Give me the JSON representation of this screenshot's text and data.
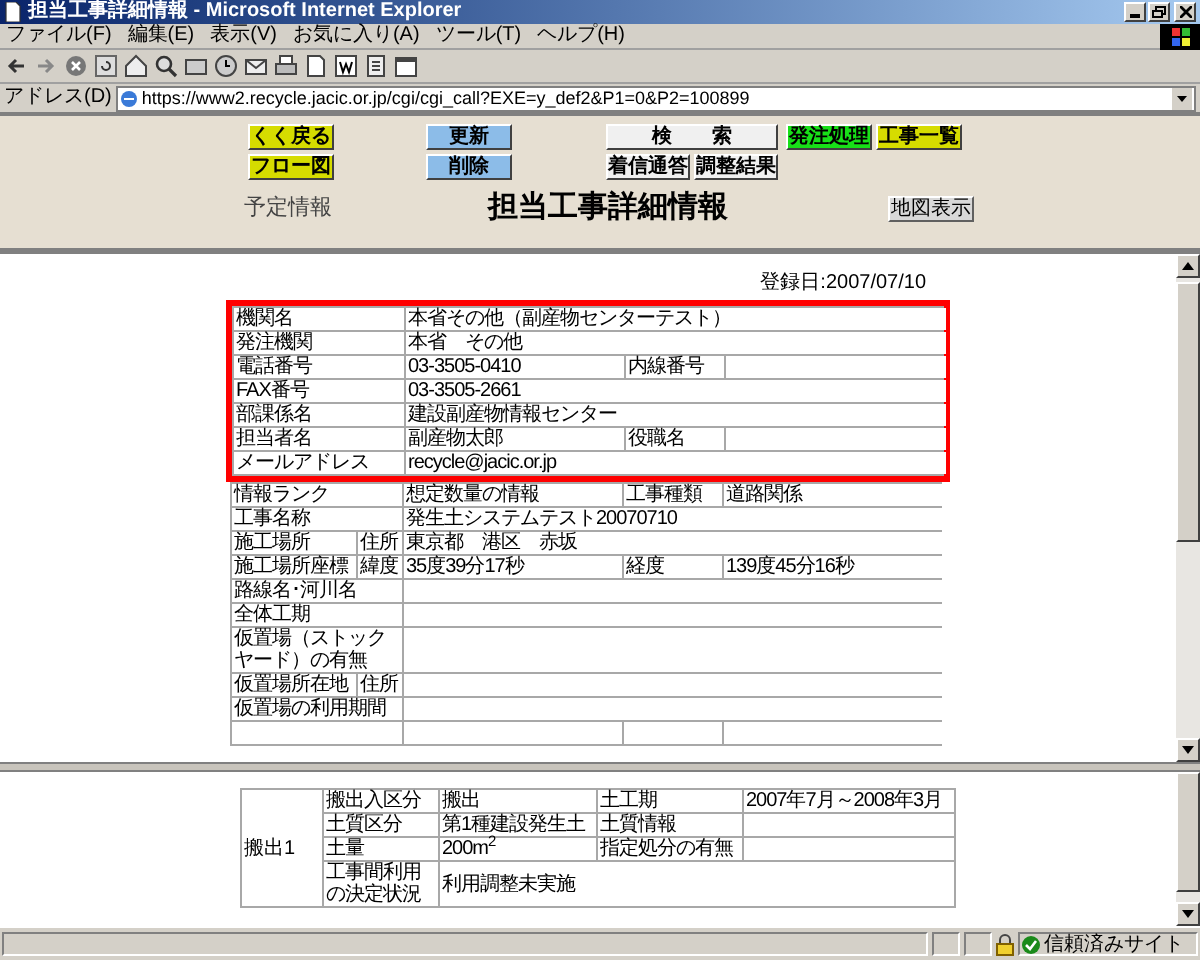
{
  "window": {
    "title": "担当工事詳細情報 - Microsoft Internet Explorer"
  },
  "menu_bar": {
    "items": [
      "ファイル(F)",
      "編集(E)",
      "表示(V)",
      "お気に入り(A)",
      "ツール(T)",
      "ヘルプ(H)"
    ]
  },
  "address_bar": {
    "label": "アドレス(D)",
    "url": "https://www2.recycle.jacic.or.jp/cgi/cgi_call?EXE=y_def2&P1=0&P2=100899"
  },
  "top_frame": {
    "button_groups": [
      {
        "buttons": [
          {
            "label": "くく戻る",
            "color": "#d6dc00"
          },
          {
            "label": "フロー図",
            "color": "#d6dc00"
          }
        ]
      },
      {
        "buttons": [
          {
            "label": "更新",
            "color": "#8cbce8"
          },
          {
            "label": "削除",
            "color": "#8cbce8"
          }
        ]
      },
      {
        "buttons": [
          {
            "label": "検　　索",
            "color": "#f0f0f0"
          },
          {
            "label": "着信通答",
            "color": "#f0f0f0"
          },
          {
            "label": "調整結果",
            "color": "#f0f0f0"
          }
        ]
      },
      {
        "buttons": [
          {
            "label": "発注処理",
            "color": "#18e018"
          }
        ]
      },
      {
        "buttons": [
          {
            "label": "工事一覧",
            "color": "#d6dc00"
          }
        ]
      }
    ],
    "subtitle": "予定情報",
    "heading": "担当工事詳細情報",
    "map_button": "地図表示"
  },
  "registration_date": "登録日:2007/07/10",
  "contact_table": {
    "highlighted": true,
    "rows": [
      {
        "kind": "full",
        "label": "機関名",
        "value": "本省その他（副産物センターテスト）"
      },
      {
        "kind": "full",
        "label": "発注機関",
        "value": "本省　その他"
      },
      {
        "kind": "pair",
        "label": "電話番号",
        "value": "03-3505-0410",
        "label2": "内線番号"
      },
      {
        "kind": "full",
        "label": "FAX番号",
        "value": "03-3505-2661"
      },
      {
        "kind": "full",
        "label": "部課係名",
        "value": "建設副産物情報センター"
      },
      {
        "kind": "pair",
        "label": "担当者名",
        "value": "副産物太郎",
        "label2": "役職名"
      },
      {
        "kind": "full",
        "label": "メールアドレス",
        "value": "recycle@jacic.or.jp"
      }
    ]
  },
  "project_table": {
    "highlighted": false,
    "rows": [
      {
        "kind": "pair",
        "label": "情報ランク",
        "value": "想定数量の情報",
        "label2": "工事種類",
        "value2": "道路関係"
      },
      {
        "kind": "full",
        "label": "工事名称",
        "value": "発生土システムテスト20070710"
      },
      {
        "kind": "sub",
        "label": "施工場所",
        "sublabel": "住所",
        "value": "東京都　港区　赤坂"
      },
      {
        "kind": "sub_pair",
        "label": "施工場所座標",
        "sublabel": "緯度",
        "value": "35度39分17秒",
        "label2": "経度",
        "value2": "139度45分16秒"
      },
      {
        "kind": "full",
        "label": "路線名･河川名"
      },
      {
        "kind": "full",
        "label": "全体工期"
      },
      {
        "kind": "full",
        "label": "仮置場（ストックヤード）の有無"
      },
      {
        "kind": "sub",
        "label": "仮置場所在地",
        "sublabel": "住所"
      },
      {
        "kind": "full",
        "label": "仮置場の利用期間"
      },
      {
        "kind": "pair"
      }
    ]
  },
  "lower_table": {
    "group_label": "搬出1",
    "rows": [
      {
        "kind": "pair",
        "label": "搬出入区分",
        "value": "搬出",
        "label2": "土工期",
        "value2": "2007年7月～2008年3月"
      },
      {
        "kind": "pair",
        "label": "土質区分",
        "value": "第1種建設発生土",
        "label2": "土質情報"
      },
      {
        "kind": "pair",
        "label": "土量",
        "value": "200m$^{2}$",
        "label2": "指定処分の有無"
      },
      {
        "kind": "full",
        "label": "工事間利用の決定状況",
        "value": "利用調整未実施"
      }
    ]
  },
  "status_bar": {
    "zone": "信頼済みサイト"
  }
}
